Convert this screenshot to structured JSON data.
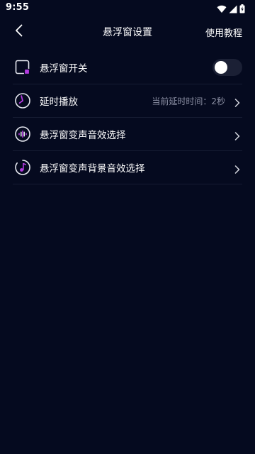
{
  "status_bar": {
    "time": "9:55",
    "icons": [
      "wifi-icon",
      "cellular-signal-icon",
      "battery-charging-icon"
    ]
  },
  "header": {
    "back_icon": "chevron-left-icon",
    "title": "悬浮窗设置",
    "tutorial_label": "使用教程"
  },
  "settings": [
    {
      "label": "悬浮窗开关",
      "icon": "floating-window-icon",
      "control": "toggle",
      "toggle_on": false
    },
    {
      "label": "延时播放",
      "icon": "clock-icon",
      "value": "当前延时时间：2秒",
      "control": "chevron"
    },
    {
      "label": "悬浮窗变声音效选择",
      "icon": "sound-wave-icon",
      "control": "chevron"
    },
    {
      "label": "悬浮窗变声背景音效选择",
      "icon": "music-note-icon",
      "control": "chevron"
    }
  ],
  "colors": {
    "background": "#050a1f",
    "accent_purple": "#b33be0",
    "secondary_text": "#8b8fa3"
  }
}
